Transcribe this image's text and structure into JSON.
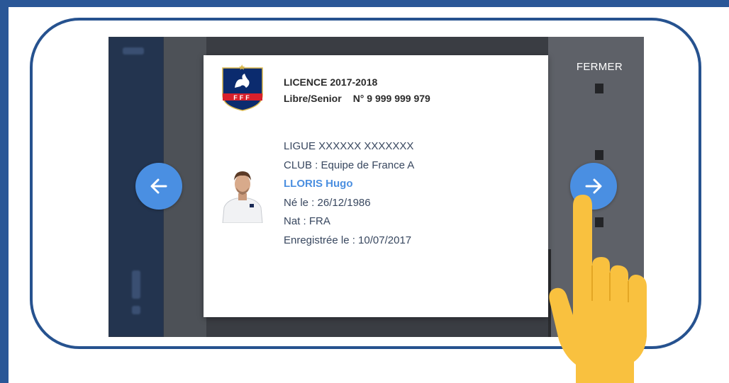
{
  "screen": {
    "close_label": "FERMER"
  },
  "licence": {
    "title": "LICENCE 2017-2018",
    "category": "Libre/Senior",
    "number": "N° 9 999 999 979",
    "crest_text": "FFF"
  },
  "player": {
    "league": "LIGUE XXXXXX XXXXXXX",
    "club": "CLUB : Equipe de France A",
    "name": "LLORIS Hugo",
    "birth": "Né le : 26/12/1986",
    "nationality": "Nat : FRA",
    "registered": "Enregistrée le : 10/07/2017"
  },
  "icons": {
    "prev": "arrow-left-icon",
    "next": "arrow-right-icon",
    "pointer": "pointing-hand-icon"
  },
  "colors": {
    "frame": "#2a5797",
    "phone_border": "#26528f",
    "accent": "#4a8fe2",
    "player_name": "#4b8fe0",
    "hand": "#f9c13f"
  }
}
